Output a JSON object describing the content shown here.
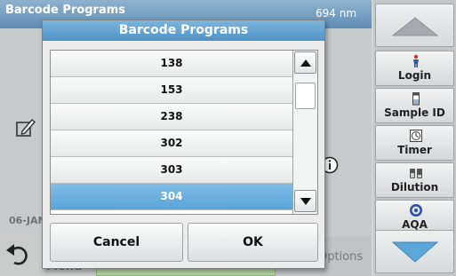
{
  "background": {
    "title": "Barcode Programs",
    "wavelength": "694 nm",
    "date": "06-JAN",
    "menu_label": "Menu",
    "options_label": "Options"
  },
  "sidebar": {
    "up_icon": "triangle-up-icon",
    "down_icon": "triangle-down-icon",
    "buttons": [
      {
        "label": "Login",
        "icon": "person-icon"
      },
      {
        "label": "Sample ID",
        "icon": "vial-icon"
      },
      {
        "label": "Timer",
        "icon": "timer-icon"
      },
      {
        "label": "Dilution",
        "icon": "dilution-icon"
      },
      {
        "label": "AQA",
        "icon": "aqa-icon"
      }
    ]
  },
  "dialog": {
    "title": "Barcode Programs",
    "items": [
      "138",
      "153",
      "238",
      "302",
      "303",
      "304"
    ],
    "selected_index": 5,
    "cancel_label": "Cancel",
    "ok_label": "OK"
  },
  "colors": {
    "accent": "#5aa4d9",
    "title_bar": "#4f93c6",
    "down_arrow": "#5aa7d8"
  }
}
